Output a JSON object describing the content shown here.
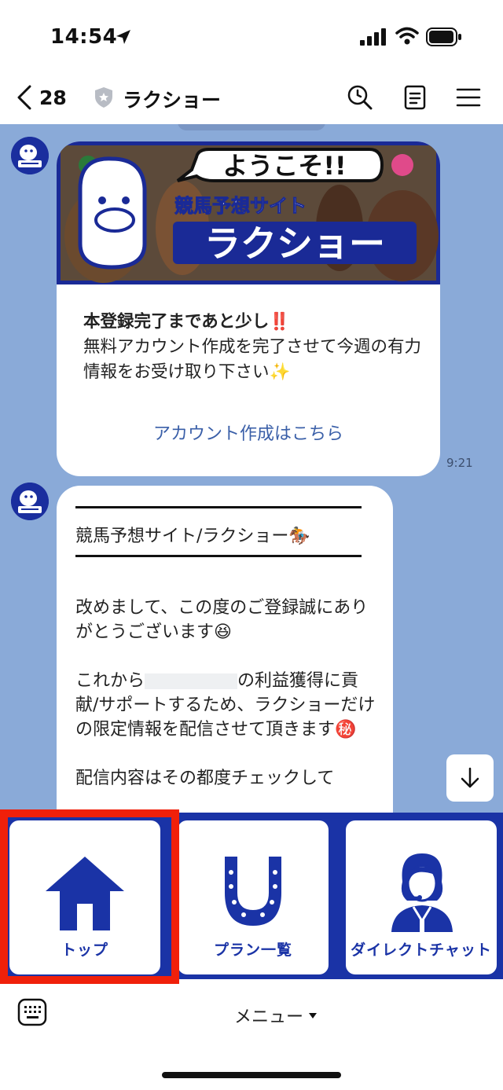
{
  "status_bar": {
    "time": "14:54"
  },
  "header": {
    "back_count": "28",
    "title": "ラクショー"
  },
  "messages": [
    {
      "banner": {
        "greeting": "ようこそ!!",
        "subtitle": "競馬予想サイト",
        "logo": "ラクショー"
      },
      "heading": "本登録完了まであと少し‼️",
      "body": "無料アカウント作成を完了させて今週の有力情報をお受け取り下さい✨",
      "link": "アカウント作成はこちら",
      "time": "9:21"
    },
    {
      "title": "競馬予想サイト/ラクショー🏇",
      "para1": "改めまして、この度のご登録誠にありがとうございます😆",
      "para2_prefix": "これから",
      "para2_suffix": "の利益獲得に貢献/サポートするため、ラクショーだけの限定情報を配信させて頂きます㊙️",
      "para3": "配信内容はその都度チェックして"
    }
  ],
  "rich_menu": {
    "items": [
      {
        "label": "トップ"
      },
      {
        "label": "プラン一覧"
      },
      {
        "label": "ダイレクトチャット"
      }
    ]
  },
  "bottom_bar": {
    "menu_label": "メニュー"
  },
  "colors": {
    "chat_bg": "#8aaad8",
    "menu_blue": "#1a33a6",
    "highlight": "#f0200a",
    "link": "#3a5fa8"
  }
}
